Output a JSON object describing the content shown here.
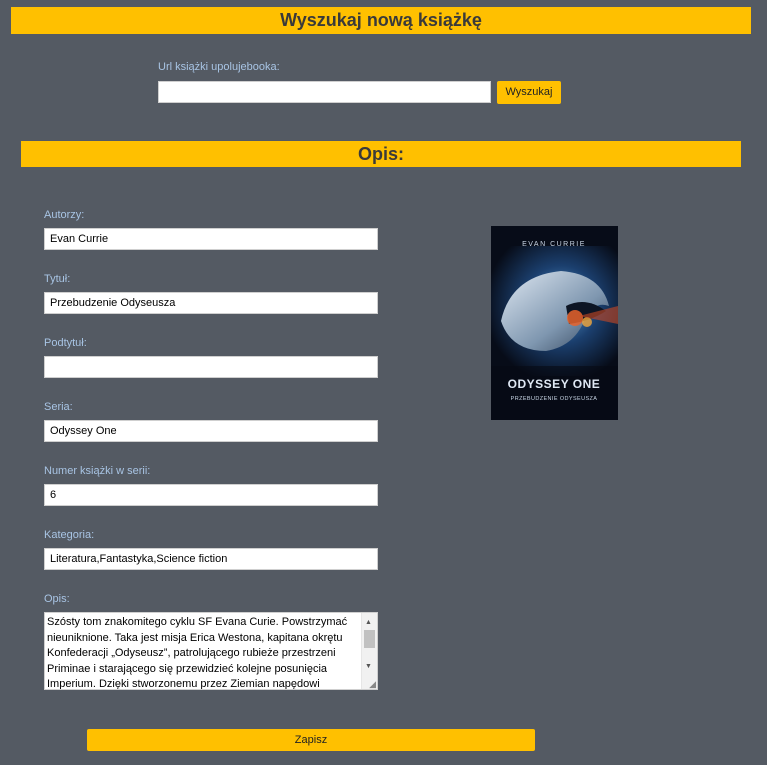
{
  "header": {
    "title": "Wyszukaj nową książkę"
  },
  "search": {
    "label": "Url książki upolujebooka:",
    "value": "",
    "button_label": "Wyszukaj"
  },
  "description_section": {
    "title": "Opis:"
  },
  "form": {
    "authors_label": "Autorzy:",
    "authors_value": "Evan Currie",
    "title_label": "Tytuł:",
    "title_value": "Przebudzenie Odyseusza",
    "subtitle_label": "Podtytuł:",
    "subtitle_value": "",
    "series_label": "Seria:",
    "series_value": "Odyssey One",
    "series_number_label": "Numer książki w serii:",
    "series_number_value": "6",
    "category_label": "Kategoria:",
    "category_value": "Literatura,Fantastyka,Science fiction",
    "description_label": "Opis:",
    "description_value": "Szósty tom znakomitego cyklu SF Evana Curie. Powstrzymać nieuniknione. Taka jest misja Erica Westona, kapitana okrętu Konfederacji „Odyseusz”, patrolującego rubieże przestrzeni Priminae i starającego się przewidzieć kolejne posunięcia Imperium. Dzięki stworzonemu przez Ziemian napędowi"
  },
  "cover": {
    "author": "EVAN CURRIE",
    "series": "ODYSSEY ONE",
    "title": "PRZEBUDZENIE ODYSEUSZA"
  },
  "save_button_label": "Zapisz",
  "colors": {
    "accent": "#ffc000",
    "background": "#545a63",
    "label": "#a8c4e4"
  }
}
